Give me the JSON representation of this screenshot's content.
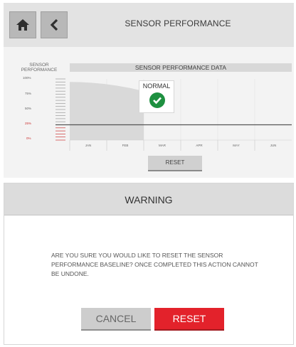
{
  "header": {
    "title": "SENSOR PERFORMANCE",
    "home_icon": "home-icon",
    "back_icon": "chevron-left-icon"
  },
  "chart": {
    "y_axis_title_line1": "SENSOR",
    "y_axis_title_line2": "PERFORMANCE",
    "title": "SENSOR PERFORMANCE DATA",
    "y_ticks": [
      "100%",
      "75%",
      "50%",
      "25%",
      "0%"
    ],
    "status_label": "NORMAL",
    "status_icon": "check-circle-icon",
    "reset_label": "RESET"
  },
  "chart_data": {
    "type": "area",
    "categories": [
      "JAN",
      "FEB",
      "MAR",
      "APR",
      "MAY",
      "JUN"
    ],
    "series": [
      {
        "values": [
          95,
          80,
          null,
          null,
          null,
          null
        ]
      }
    ],
    "baseline": 25,
    "title": "SENSOR PERFORMANCE DATA",
    "ylabel": "SENSOR PERFORMANCE",
    "ylim": [
      0,
      100
    ],
    "y_unit": "%",
    "grid": true,
    "colors": {
      "fill": "#d9d9d9",
      "baseline": "#555555",
      "low_ticks": "#cc3333"
    }
  },
  "dialog": {
    "title": "WARNING",
    "message": "ARE YOU SURE YOU WOULD LIKE TO RESET THE SENSOR PERFORMANCE BASELINE? ONCE COMPLETED THIS ACTION CANNOT BE UNDONE.",
    "cancel_label": "CANCEL",
    "reset_label": "RESET"
  },
  "colors": {
    "accent_red": "#e3222b",
    "ok_green": "#1e9040",
    "button_gray": "#cdcdcd"
  }
}
